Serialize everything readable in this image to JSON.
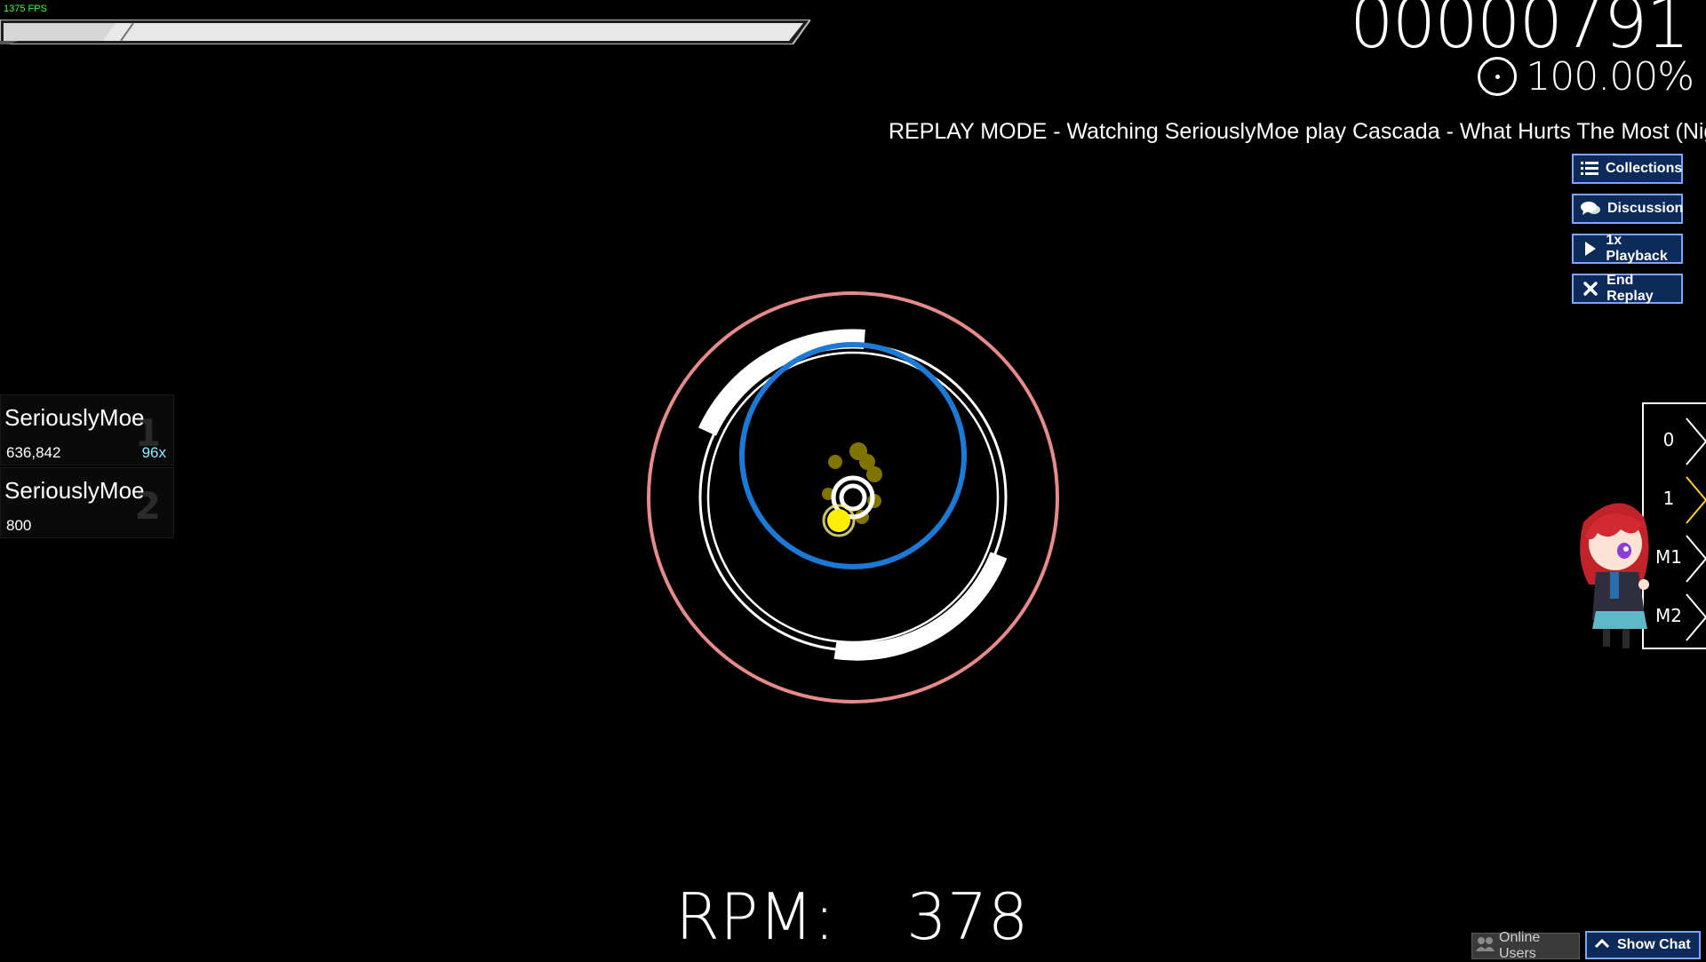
{
  "hud": {
    "fps": "1375 FPS",
    "score": "00000791",
    "accuracy": "100.00%",
    "replay_text": "REPLAY MODE - Watching SeriouslyMoe play Cascada - What Hurts The Most (Nigh",
    "rpm_label": "RPM:",
    "rpm_value": "378",
    "health_fraction": 0.14
  },
  "side_buttons": [
    {
      "label": "Collections",
      "icon": "list-icon"
    },
    {
      "label": "Discussion",
      "icon": "chat-bubbles-icon"
    },
    {
      "label": "1x Playback",
      "icon": "play-icon"
    },
    {
      "label": "End Replay",
      "icon": "close-icon"
    }
  ],
  "scoreboard": [
    {
      "name": "SeriouslyMoe",
      "score": "636,842",
      "combo": "96x",
      "rank": "1"
    },
    {
      "name": "SeriouslyMoe",
      "score": "800",
      "combo": "",
      "rank": "2"
    }
  ],
  "keys": [
    {
      "label": "0"
    },
    {
      "label": "1"
    },
    {
      "label": "M1"
    },
    {
      "label": "M2"
    }
  ],
  "bottom": {
    "online_users": "Online Users",
    "show_chat": "Show Chat"
  },
  "colors": {
    "approach_ring": "#e88a8a",
    "spinner_blue": "#1a7ad6",
    "cursor": "#ffee00",
    "button_bg": "#0c2a5a",
    "button_border": "#7aa6ff"
  }
}
